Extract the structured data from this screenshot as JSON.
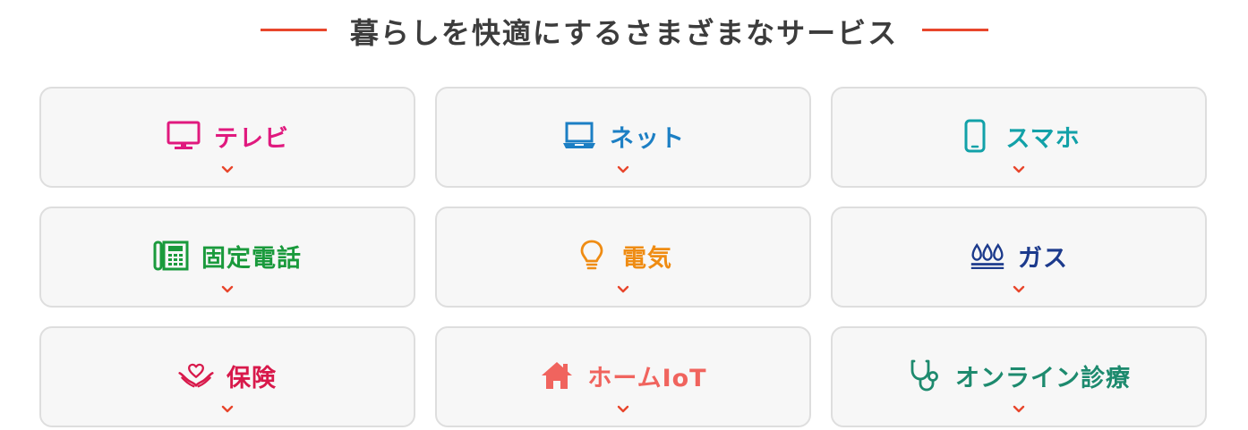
{
  "section_title": "暮らしを快適にするさまざまなサービス",
  "colors": {
    "accent": "#e8462c",
    "card_bg": "#f7f7f7",
    "card_border": "#dedede"
  },
  "services": [
    {
      "label": "テレビ",
      "icon": "tv-icon",
      "color": "#e0197e"
    },
    {
      "label": "ネット",
      "icon": "laptop-icon",
      "color": "#1c7fc4"
    },
    {
      "label": "スマホ",
      "icon": "smartphone-icon",
      "color": "#12a1a8"
    },
    {
      "label": "固定電話",
      "icon": "landline-phone-icon",
      "color": "#1a9a3c"
    },
    {
      "label": "電気",
      "icon": "lightbulb-icon",
      "color": "#ef8c13"
    },
    {
      "label": "ガス",
      "icon": "gas-flame-icon",
      "color": "#1c3a8c"
    },
    {
      "label": "保険",
      "icon": "heart-hands-icon",
      "color": "#d8194b"
    },
    {
      "label": "ホームIoT",
      "icon": "house-icon",
      "color": "#f0645e"
    },
    {
      "label": "オンライン診療",
      "icon": "stethoscope-icon",
      "color": "#1d8a6e"
    }
  ]
}
